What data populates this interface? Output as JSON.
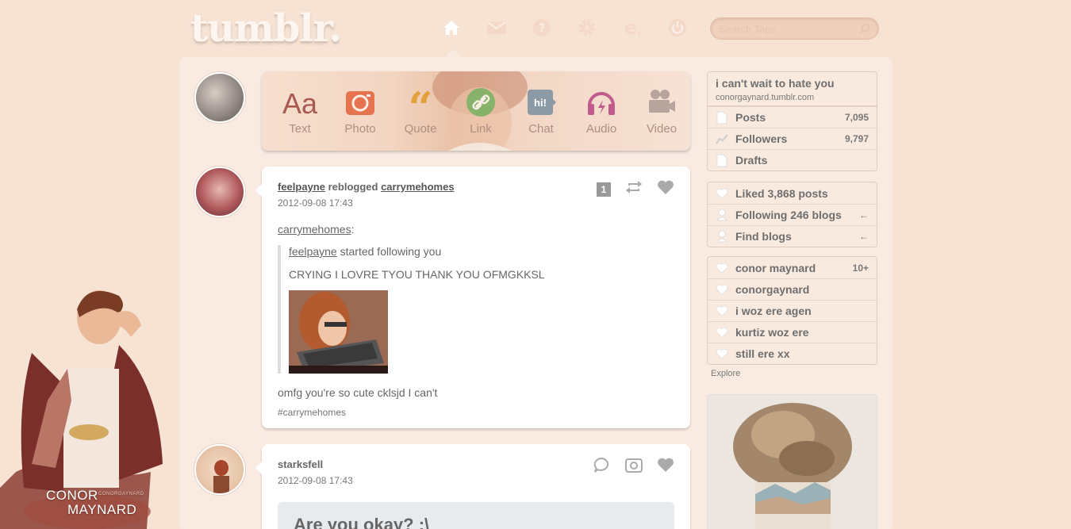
{
  "header": {
    "logo": "tumblr.",
    "nav": [
      "home-icon",
      "mail-icon",
      "help-icon",
      "settings-icon",
      "edit-icon",
      "power-icon"
    ],
    "search_placeholder": "Search Tags"
  },
  "post_types": [
    {
      "label": "Text",
      "icon": "text-icon",
      "color": "#a9594f"
    },
    {
      "label": "Photo",
      "icon": "camera-icon",
      "color": "#e5734f"
    },
    {
      "label": "Quote",
      "icon": "quote-icon",
      "color": "#e3a13c"
    },
    {
      "label": "Link",
      "icon": "link-icon",
      "color": "#86b26a"
    },
    {
      "label": "Chat",
      "icon": "chat-icon",
      "color": "#8c9aa6"
    },
    {
      "label": "Audio",
      "icon": "audio-icon",
      "color": "#c15b8e"
    },
    {
      "label": "Video",
      "icon": "video-icon",
      "color": "#b6a49d"
    }
  ],
  "posts": [
    {
      "user": "feelpayne",
      "action": "reblogged",
      "source": "carrymehomes",
      "date": "2012-09-08 17:43",
      "badge": "1",
      "quote_source": "carrymehomes",
      "quote_line1_user": "feelpayne",
      "quote_line1_text": "started following you",
      "quote_line2": "CRYING I LOVRE TYOU THANK YOU OFMGKKSL",
      "body": "omfg you're so cute cklsjd I can't",
      "tag": "#carrymehomes"
    },
    {
      "user": "starksfell",
      "date": "2012-09-08 17:43",
      "title": "Are you okay? :\\"
    }
  ],
  "sidebar": {
    "blog_title": "i can't wait to hate you",
    "blog_url": "conorgaynard.tumblr.com",
    "stats": [
      {
        "label": "Posts",
        "value": "7,095"
      },
      {
        "label": "Followers",
        "value": "9,797"
      },
      {
        "label": "Drafts",
        "value": ""
      }
    ],
    "links": [
      {
        "label": "Liked 3,868 posts",
        "value": ""
      },
      {
        "label": "Following 246 blogs",
        "value": "←"
      },
      {
        "label": "Find blogs",
        "value": "←"
      }
    ],
    "blogs": [
      {
        "label": "conor maynard",
        "value": "10+"
      },
      {
        "label": "conorgaynard",
        "value": ""
      },
      {
        "label": "i woz ere agen",
        "value": ""
      },
      {
        "label": "kurtiz woz ere",
        "value": ""
      },
      {
        "label": "still ere xx",
        "value": ""
      }
    ],
    "explore": "Explore"
  },
  "background_art": {
    "name_line1": "CONOR",
    "name_line2": "MAYNARD",
    "small_text": "CONORGAYNARD"
  }
}
